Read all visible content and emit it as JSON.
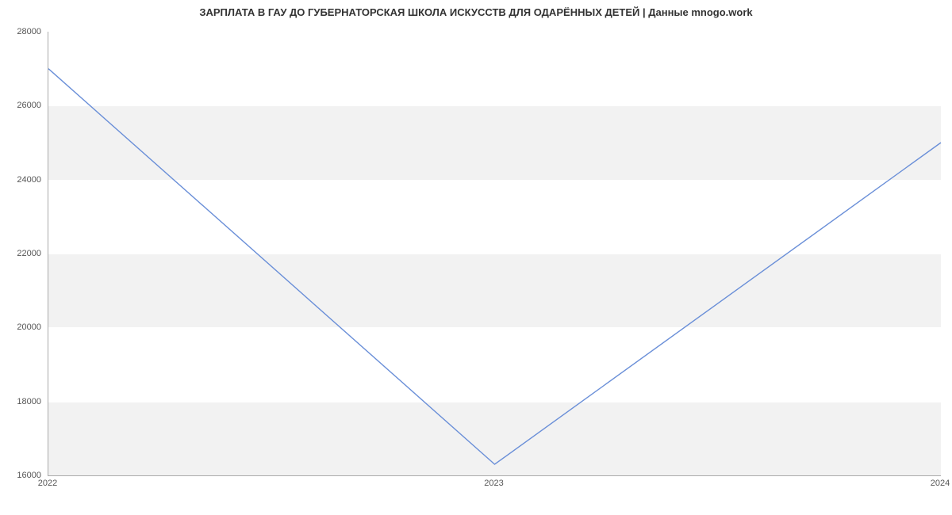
{
  "chart_data": {
    "type": "line",
    "title": "ЗАРПЛАТА В ГАУ ДО ГУБЕРНАТОРСКАЯ ШКОЛА ИСКУССТВ ДЛЯ ОДАРЁННЫХ ДЕТЕЙ | Данные mnogo.work",
    "x": [
      2022,
      2023,
      2024
    ],
    "values": [
      27000,
      16300,
      25000
    ],
    "xticks": [
      2022,
      2023,
      2024
    ],
    "yticks": [
      16000,
      18000,
      20000,
      22000,
      24000,
      26000,
      28000
    ],
    "ylim": [
      16000,
      28000
    ],
    "xlim": [
      2022,
      2024
    ],
    "xlabel": "",
    "ylabel": "",
    "line_color": "#6a8fd8",
    "band_color": "#f2f2f2"
  }
}
